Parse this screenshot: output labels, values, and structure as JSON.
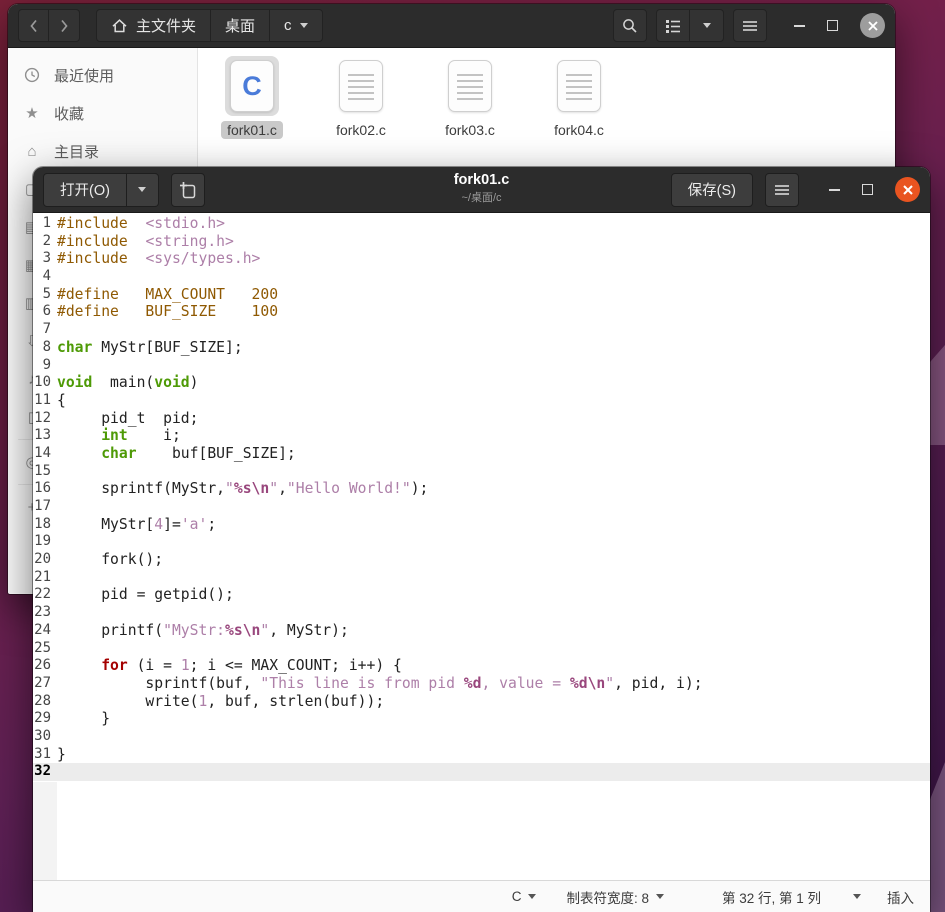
{
  "file_manager": {
    "path": [
      {
        "label": "主文件夹",
        "icon": "home"
      },
      {
        "label": "桌面"
      },
      {
        "label": "c",
        "caret": true
      }
    ],
    "sidebar": {
      "items": [
        {
          "icon": "clock",
          "label": "最近使用"
        },
        {
          "icon": "star",
          "label": "收藏"
        },
        {
          "icon": "home",
          "label": "主目录"
        }
      ],
      "covered_icons": [
        "desktop",
        "film",
        "image",
        "document",
        "download",
        "music",
        "trash",
        "divider",
        "disc",
        "divider",
        "plus"
      ]
    },
    "files": [
      {
        "name": "fork01.c",
        "type": "c",
        "icon_letter": "C",
        "selected": true
      },
      {
        "name": "fork02.c",
        "type": "text",
        "selected": false
      },
      {
        "name": "fork03.c",
        "type": "text",
        "selected": false
      },
      {
        "name": "fork04.c",
        "type": "text",
        "selected": false
      }
    ]
  },
  "gedit": {
    "header": {
      "open_label": "打开(O)",
      "save_label": "保存(S)",
      "title": "fork01.c",
      "subtitle": "~/桌面/c"
    },
    "status": {
      "lang": "C",
      "tab_width": "制表符宽度: 8",
      "position": "第 32 行, 第 1 列",
      "mode": "插入"
    },
    "code": {
      "current_line": 32,
      "lines": [
        [
          [
            "pp",
            "#include"
          ],
          [
            "txt",
            "  "
          ],
          [
            "str",
            "<stdio.h>"
          ]
        ],
        [
          [
            "pp",
            "#include"
          ],
          [
            "txt",
            "  "
          ],
          [
            "str",
            "<string.h>"
          ]
        ],
        [
          [
            "pp",
            "#include"
          ],
          [
            "txt",
            "  "
          ],
          [
            "str",
            "<sys/types.h>"
          ]
        ],
        [],
        [
          [
            "pp",
            "#define   MAX_COUNT   200"
          ]
        ],
        [
          [
            "pp",
            "#define   BUF_SIZE    100"
          ]
        ],
        [],
        [
          [
            "type",
            "char"
          ],
          [
            "txt",
            " MyStr[BUF_SIZE];"
          ]
        ],
        [],
        [
          [
            "type",
            "void"
          ],
          [
            "txt",
            "  main("
          ],
          [
            "type",
            "void"
          ],
          [
            "txt",
            ")"
          ]
        ],
        [
          [
            "txt",
            "{"
          ]
        ],
        [
          [
            "txt",
            "     pid_t  pid;"
          ]
        ],
        [
          [
            "txt",
            "     "
          ],
          [
            "type",
            "int"
          ],
          [
            "txt",
            "    i;"
          ]
        ],
        [
          [
            "txt",
            "     "
          ],
          [
            "type",
            "char"
          ],
          [
            "txt",
            "    buf[BUF_SIZE];"
          ]
        ],
        [],
        [
          [
            "txt",
            "     sprintf(MyStr,"
          ],
          [
            "str",
            "\""
          ],
          [
            "esc",
            "%s\\n"
          ],
          [
            "str",
            "\""
          ],
          [
            "txt",
            ","
          ],
          [
            "str",
            "\"Hello World!\""
          ],
          [
            "txt",
            ");"
          ]
        ],
        [],
        [
          [
            "txt",
            "     MyStr["
          ],
          [
            "num",
            "4"
          ],
          [
            "txt",
            "]="
          ],
          [
            "str",
            "'a'"
          ],
          [
            "txt",
            ";"
          ]
        ],
        [],
        [
          [
            "txt",
            "     fork();"
          ]
        ],
        [],
        [
          [
            "txt",
            "     pid = getpid();"
          ]
        ],
        [],
        [
          [
            "txt",
            "     printf("
          ],
          [
            "str",
            "\"MyStr:"
          ],
          [
            "esc",
            "%s\\n"
          ],
          [
            "str",
            "\""
          ],
          [
            "txt",
            ", MyStr);"
          ]
        ],
        [],
        [
          [
            "txt",
            "     "
          ],
          [
            "kw",
            "for"
          ],
          [
            "txt",
            " (i = "
          ],
          [
            "num",
            "1"
          ],
          [
            "txt",
            "; i <= MAX_COUNT; i++) {"
          ]
        ],
        [
          [
            "txt",
            "          sprintf(buf, "
          ],
          [
            "str",
            "\"This line is from pid "
          ],
          [
            "esc",
            "%d"
          ],
          [
            "str",
            ", value = "
          ],
          [
            "esc",
            "%d\\n"
          ],
          [
            "str",
            "\""
          ],
          [
            "txt",
            ", pid, i);"
          ]
        ],
        [
          [
            "txt",
            "          write("
          ],
          [
            "num",
            "1"
          ],
          [
            "txt",
            ", buf, strlen(buf));"
          ]
        ],
        [
          [
            "txt",
            "     }"
          ]
        ],
        [],
        [
          [
            "txt",
            "}"
          ]
        ],
        []
      ]
    }
  },
  "colors": {
    "accent_close": "#e95420",
    "inactive_close": "#9d9d9d",
    "headerbar": "#2c2c2c",
    "selection_gray": "#c9c9c9",
    "syntax": {
      "preprocessor": "#8f5902",
      "string": "#ad7fa8",
      "format_specifier": "#99477d",
      "keyword": "#a40000",
      "type": "#4e9a06"
    }
  }
}
